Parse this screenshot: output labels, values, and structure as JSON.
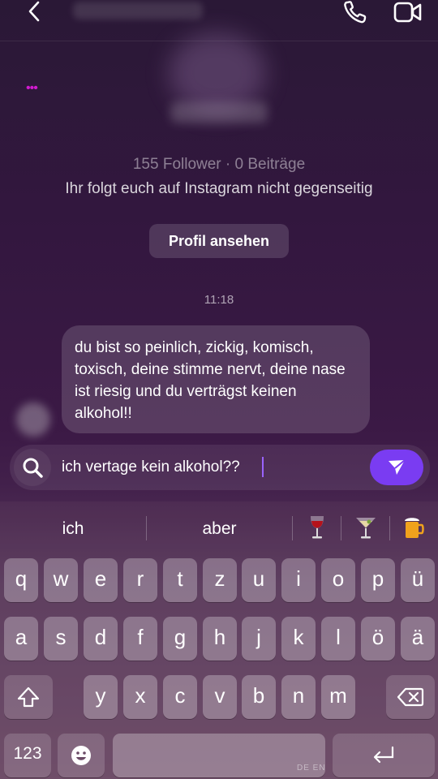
{
  "header": {
    "back_icon": "chevron-left-icon",
    "call_icon": "phone-icon",
    "video_icon": "video-camera-icon"
  },
  "profile": {
    "dots": "•••",
    "stats": "155 Follower · 0 Beiträge",
    "follow_note": "Ihr folgt euch auf Instagram nicht gegenseitig",
    "view_profile_label": "Profil ansehen"
  },
  "thread": {
    "timestamp": "11:18",
    "messages": [
      {
        "text": "du bist so peinlich, zickig, komisch, toxisch, deine stimme nervt, deine nase ist riesig und du verträgst keinen alkohol!!"
      }
    ]
  },
  "composer": {
    "value": "ich vertage kein alkohol??",
    "search_icon": "search-icon",
    "send_icon": "send-icon",
    "accent": "#7a3cf2"
  },
  "keyboard": {
    "suggestions": [
      "ich",
      "aber"
    ],
    "emoji_suggestions": [
      "🍷",
      "🍸",
      "🍺"
    ],
    "row1": [
      "q",
      "w",
      "e",
      "r",
      "t",
      "z",
      "u",
      "i",
      "o",
      "p",
      "ü"
    ],
    "row2": [
      "a",
      "s",
      "d",
      "f",
      "g",
      "h",
      "j",
      "k",
      "l",
      "ö",
      "ä"
    ],
    "row3": [
      "y",
      "x",
      "c",
      "v",
      "b",
      "n",
      "m"
    ],
    "numbers_key": "123",
    "languages": "DE EN"
  }
}
